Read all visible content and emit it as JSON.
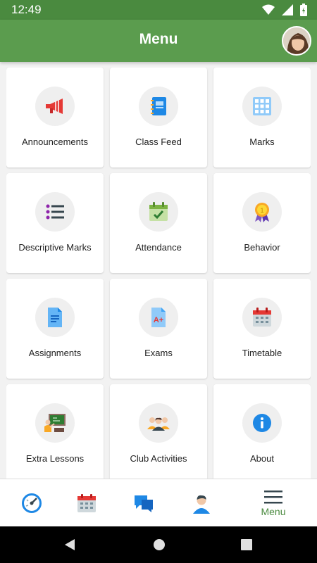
{
  "status_bar": {
    "time": "12:49"
  },
  "header": {
    "title": "Menu"
  },
  "menu_items": [
    {
      "label": "Announcements",
      "icon": "megaphone-icon"
    },
    {
      "label": "Class Feed",
      "icon": "notebook-icon"
    },
    {
      "label": "Marks",
      "icon": "grid-icon"
    },
    {
      "label": "Descriptive Marks",
      "icon": "list-icon"
    },
    {
      "label": "Attendance",
      "icon": "calendar-check-icon"
    },
    {
      "label": "Behavior",
      "icon": "medal-icon"
    },
    {
      "label": "Assignments",
      "icon": "document-icon"
    },
    {
      "label": "Exams",
      "icon": "graded-paper-icon"
    },
    {
      "label": "Timetable",
      "icon": "calendar-icon"
    },
    {
      "label": "Extra Lessons",
      "icon": "teacher-board-icon"
    },
    {
      "label": "Club Activities",
      "icon": "group-icon"
    },
    {
      "label": "About",
      "icon": "info-icon"
    }
  ],
  "bottom_nav": {
    "items": [
      {
        "icon": "gauge-icon"
      },
      {
        "icon": "calendar-icon"
      },
      {
        "icon": "chat-icon"
      },
      {
        "icon": "profile-icon"
      },
      {
        "icon": "hamburger-menu-icon",
        "label": "Menu",
        "active": true
      }
    ]
  },
  "colors": {
    "app_bar": "#5b9c4e",
    "status_bar": "#4a8a3f",
    "accent": "#4a8a3f"
  }
}
